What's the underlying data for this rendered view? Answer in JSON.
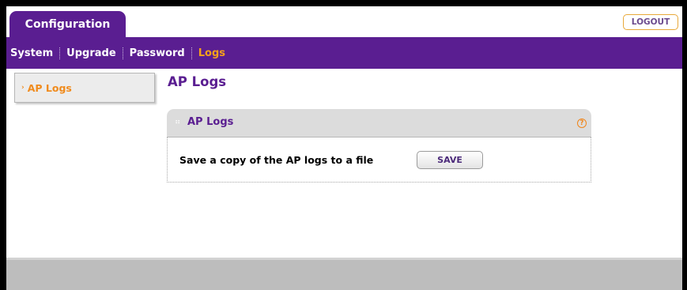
{
  "header": {
    "tab_label": "Configuration",
    "logout_label": "LOGOUT"
  },
  "nav": {
    "items": [
      {
        "label": "System",
        "active": false
      },
      {
        "label": "Upgrade",
        "active": false
      },
      {
        "label": "Password",
        "active": false
      },
      {
        "label": "Logs",
        "active": true
      }
    ]
  },
  "sidebar": {
    "items": [
      {
        "label": "AP Logs",
        "chevron": "›",
        "selected": true
      }
    ]
  },
  "main": {
    "page_title": "AP Logs",
    "panel": {
      "title": "AP Logs",
      "help_icon": "?",
      "row_label": "Save a copy of the AP logs to a file",
      "save_label": "SAVE"
    }
  },
  "colors": {
    "brand_purple": "#5a1e91",
    "accent_orange": "#f7a11a"
  }
}
